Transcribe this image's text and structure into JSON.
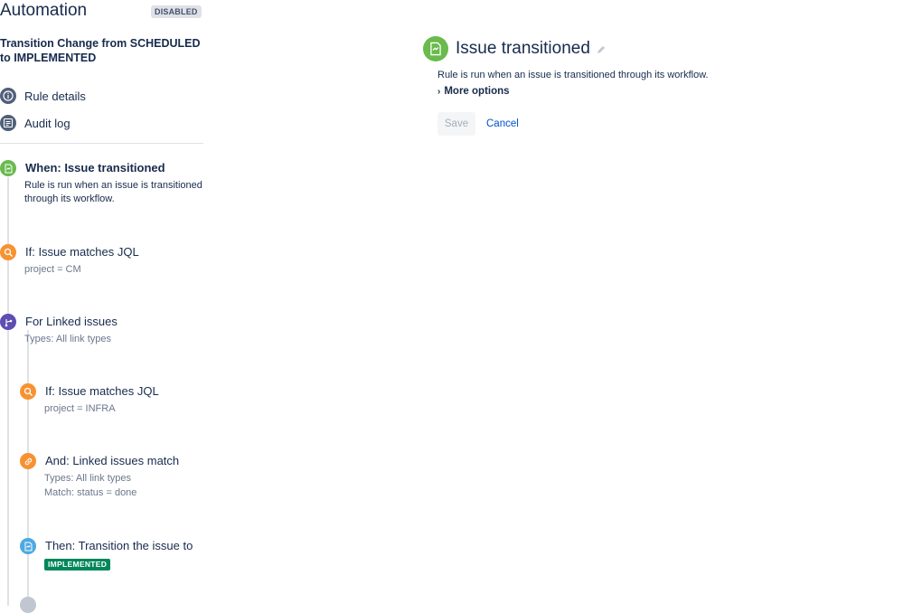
{
  "header": {
    "app_title": "Automation",
    "status_badge": "DISABLED",
    "rule_name": "Transition Change from SCHEDULED to IMPLEMENTED"
  },
  "nav": {
    "items": [
      {
        "label": "Rule details",
        "icon": "info-icon"
      },
      {
        "label": "Audit log",
        "icon": "list-icon"
      }
    ]
  },
  "steps": {
    "trigger": {
      "title": "When: Issue transitioned",
      "desc": "Rule is run when an issue is transitioned through its workflow.",
      "icon": "transition-icon",
      "color": "#6aba4d"
    },
    "condition1": {
      "title": "If: Issue matches JQL",
      "sub": "project = CM",
      "icon": "search-icon",
      "color": "#f79232"
    },
    "branch": {
      "title": "For Linked issues",
      "sub": "Types: All link types",
      "icon": "branch-icon",
      "color": "#5e4db2"
    },
    "condition2": {
      "title": "If: Issue matches JQL",
      "sub": "project = INFRA",
      "icon": "search-icon",
      "color": "#f79232"
    },
    "condition3": {
      "title": "And: Linked issues match",
      "sub1": "Types: All link types",
      "sub2": "Match: status = done",
      "icon": "link-icon",
      "color": "#f79232"
    },
    "action": {
      "title": "Then: Transition the issue to",
      "status": "IMPLEMENTED",
      "icon": "transition-icon",
      "color": "#4ca9e2"
    }
  },
  "detail": {
    "title": "Issue transitioned",
    "desc": "Rule is run when an issue is transitioned through its workflow.",
    "more_options": "More options",
    "save_label": "Save",
    "cancel_label": "Cancel",
    "icon": "transition-icon",
    "edit_icon": "pencil-icon"
  }
}
